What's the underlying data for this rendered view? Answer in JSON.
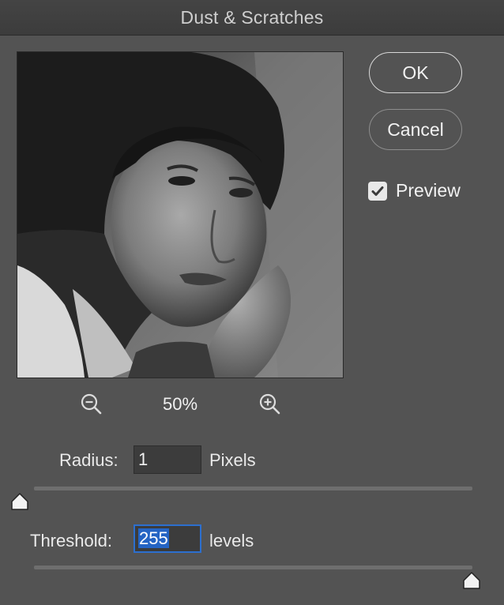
{
  "dialog": {
    "title": "Dust & Scratches"
  },
  "buttons": {
    "ok": "OK",
    "cancel": "Cancel"
  },
  "preview_toggle": {
    "label": "Preview",
    "checked": true
  },
  "zoom": {
    "level": "50%"
  },
  "radius": {
    "label": "Radius:",
    "value": "1",
    "unit": "Pixels",
    "slider_fraction": 0.0
  },
  "threshold": {
    "label": "Threshold:",
    "value": "255",
    "unit": "levels",
    "slider_fraction": 1.0
  },
  "icons": {
    "zoom_out": "zoom-out-icon",
    "zoom_in": "zoom-in-icon",
    "checkmark": "checkmark-icon"
  },
  "colors": {
    "background": "#535353",
    "accent": "#2c6fcf"
  }
}
